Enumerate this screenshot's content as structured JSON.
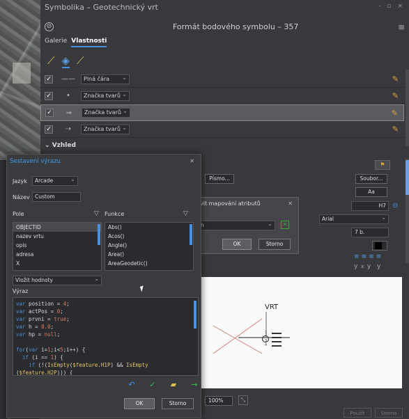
{
  "window": {
    "title": "Symbolika – Geotechnický vrt",
    "controls": "- ▫ ×"
  },
  "header": {
    "title": "Formát bodového symbolu – 357",
    "menu_icon": "≡",
    "back_icon": "⊝"
  },
  "tabs": [
    {
      "label": "Galerie",
      "active": false
    },
    {
      "label": "Vlastnosti",
      "active": true
    }
  ],
  "tools": [
    {
      "icon": "pencil-icon",
      "glyph": "⟋"
    },
    {
      "icon": "layers-icon",
      "glyph": "◈"
    },
    {
      "icon": "wrench-icon",
      "glyph": "⟋"
    }
  ],
  "layers": [
    {
      "checked": true,
      "glyph": "——",
      "type": "Plná čára",
      "selected": false
    },
    {
      "checked": true,
      "glyph": "•",
      "type": "Značka tvarů",
      "selected": false
    },
    {
      "checked": true,
      "glyph": "⇒",
      "type": "Značka tvarů",
      "selected": true
    },
    {
      "checked": true,
      "glyph": "⇢",
      "type": "Značka tvarů",
      "selected": false
    }
  ],
  "section": {
    "vzhled": "Vzhled"
  },
  "right_panel": {
    "pismo": "Písmo...",
    "soubor": "Soubor...",
    "aa": "Aa",
    "h7": "H7",
    "arial": "Arial",
    "size": "7 b."
  },
  "preview": {
    "label": "VRT",
    "zoom": "100%",
    "marks": [
      "1",
      "2",
      "3",
      "4"
    ]
  },
  "bottom": {
    "pouzit": "Použít",
    "storno": "Storno"
  },
  "mapping_dialog": {
    "title": "vit mapování atributů",
    "value": "n",
    "ok": "OK",
    "storno": "Storno"
  },
  "expression_builder": {
    "title": "Sestavení výrazu",
    "language_label": "Jazyk",
    "language_value": "Arcade",
    "name_label": "Název",
    "name_value": "Custom",
    "fields_label": "Pole",
    "functions_label": "Funkce",
    "fields": [
      "OBJECTID",
      "nazev vrtu",
      "opis",
      "adresa",
      "X"
    ],
    "functions": [
      "Abs()",
      "Acos()",
      "Angle()",
      "Area()",
      "AreaGeodetic()"
    ],
    "insert_value": "Vložit hodnoty",
    "expression_label": "Výraz",
    "code_lines": [
      "var position = 4;",
      "var actPos = 0;",
      "var prvni = true;",
      "var h = 0.0;",
      "var hp = null;",
      "",
      "for(var i=1;i<5;i++) {",
      "  if (i == 1) {",
      "    if (!(IsEmpty($feature.H1P) && IsEmpty",
      "($feature.H2P))) {"
    ],
    "ok": "OK",
    "storno": "Storno"
  }
}
